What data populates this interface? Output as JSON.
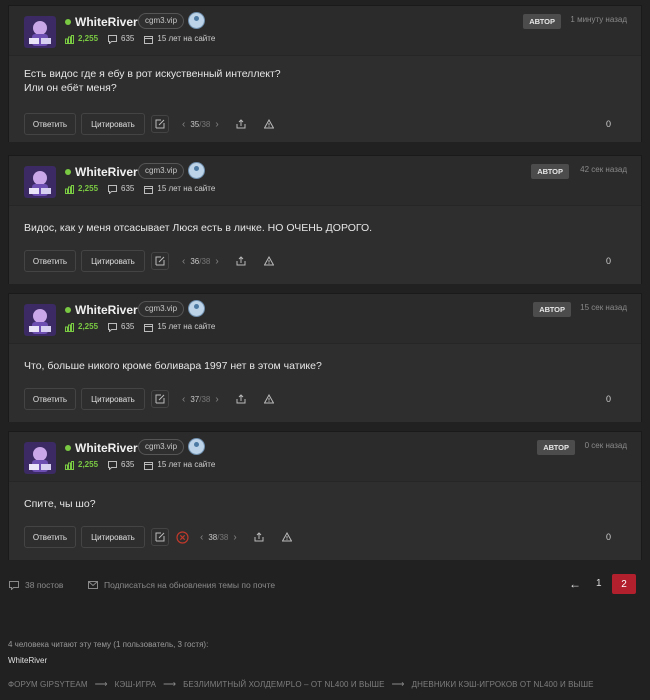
{
  "posts": [
    {
      "username": "WhiteRiver",
      "site_tag": "cgm3.vip",
      "rating": "2,255",
      "messages": "635",
      "tenure": "15 лет на сайте",
      "author_badge": "АВТОР",
      "time": "1 минуту назад",
      "text_lines": [
        "Есть видос где я ебу в рот искуственный интеллект?",
        "Или он ебёт меня?"
      ],
      "reply_label": "Ответить",
      "quote_label": "Цитировать",
      "post_num": "35",
      "post_total": "/38",
      "likes": "0"
    },
    {
      "username": "WhiteRiver",
      "site_tag": "cgm3.vip",
      "rating": "2,255",
      "messages": "635",
      "tenure": "15 лет на сайте",
      "author_badge": "АВТОР",
      "time": "42 сек назад",
      "text_lines": [
        "Видос, как у меня отсасывает Люся есть в личке. НО ОЧЕНЬ ДОРОГО."
      ],
      "reply_label": "Ответить",
      "quote_label": "Цитировать",
      "post_num": "36",
      "post_total": "/38",
      "likes": "0"
    },
    {
      "username": "WhiteRiver",
      "site_tag": "cgm3.vip",
      "rating": "2,255",
      "messages": "635",
      "tenure": "15 лет на сайте",
      "author_badge": "АВТОР",
      "time": "15 сек назад",
      "text_lines": [
        "Что, больше никого кроме боливара 1997 нет в этом чатике?"
      ],
      "reply_label": "Ответить",
      "quote_label": "Цитировать",
      "post_num": "37",
      "post_total": "/38",
      "likes": "0"
    },
    {
      "username": "WhiteRiver",
      "site_tag": "cgm3.vip",
      "rating": "2,255",
      "messages": "635",
      "tenure": "15 лет на сайте",
      "author_badge": "АВТОР",
      "time": "0 сек назад",
      "text_lines": [
        "Спите, чы шо?"
      ],
      "reply_label": "Ответить",
      "quote_label": "Цитировать",
      "post_num": "38",
      "post_total": "/38",
      "likes": "0"
    }
  ],
  "footer": {
    "post_count": "38 постов",
    "subscribe": "Подписаться на обновления темы по почте",
    "arrow": "←",
    "page_1": "1",
    "page_2": "2"
  },
  "readers": {
    "summary": "4 человека читают эту тему (1 пользователь, 3 гостя):",
    "names": "WhiteRiver"
  },
  "breadcrumbs": [
    "ФОРУМ GIPSYTEAM",
    "КЭШ-ИГРА",
    "БЕЗЛИМИТНЫЙ ХОЛДЕМ/PLO – ОТ NL400 И ВЫШЕ",
    "ДНЕВНИКИ КЭШ-ИГРОКОВ ОТ NL400 И ВЫШЕ"
  ],
  "breadcrumb_separator": "⟶",
  "colors": {
    "accent_red": "#b21f2d",
    "online_green": "#7ac943",
    "background": "#212121"
  }
}
